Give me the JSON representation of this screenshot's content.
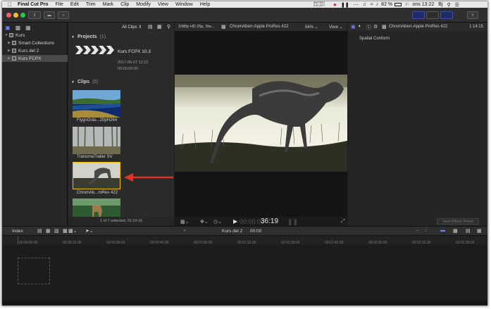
{
  "menubar": {
    "apple_icon": "apple-icon",
    "items": [
      "Final Cut Pro",
      "File",
      "Edit",
      "Trim",
      "Mark",
      "Clip",
      "Modify",
      "View",
      "Window",
      "Help"
    ],
    "status_text": "BATTERY\n5:00 LEFT",
    "battery": "82 %",
    "clock": "ons 13:22",
    "user": "Bj"
  },
  "sidebar": {
    "library": "Kurs",
    "items": [
      {
        "label": "Smart Collections"
      },
      {
        "label": "Kurs del 2"
      },
      {
        "label": "Kurs FCPX",
        "selected": true
      }
    ]
  },
  "browser": {
    "filter": "All Clips",
    "projects_heading": "Projects",
    "projects_count": "(1)",
    "project_name": "Kurs FCPX 10.3",
    "project_date": "2017-06-07 12:22",
    "project_duration": "00:00:00:00",
    "clips_heading": "Clips",
    "clips_count": "(6)",
    "clips": [
      {
        "label": "FlygnGräs...20pH264"
      },
      {
        "label": "TranornaTrailer SV"
      },
      {
        "label": "ChromAb...roRes 422",
        "selected": true
      },
      {
        "label": ""
      }
    ],
    "footer": "1 of 7 selected, 01:14:15"
  },
  "viewer": {
    "format": "1080p HD 25p, Ste...",
    "clip_name": "ChromAberr-Apple ProRes 422",
    "zoom": "54%",
    "view_menu": "View",
    "timecode": "36:19",
    "timecode_prefix": "00:00:00"
  },
  "inspector": {
    "clip_name": "ChromAberr-Apple ProRes 422",
    "duration": "1:14:15",
    "section": "Spatial Conform",
    "save_preset": "Save Effects Preset"
  },
  "timeline": {
    "index": "Index",
    "project": "Kurs del 2",
    "time": "00:00",
    "ruler": [
      "00:00:00:00",
      "00:00:15:00",
      "00:00:30:00",
      "00:00:45:00",
      "00:01:00:00",
      "00:01:15:00",
      "00:01:30:00",
      "00:01:45:00",
      "00:02:00:00",
      "00:02:15:00",
      "00:02:30:00"
    ]
  },
  "colors": {
    "accent": "#6b86ff",
    "selection": "#f0c000",
    "arrow": "#e0332c"
  }
}
